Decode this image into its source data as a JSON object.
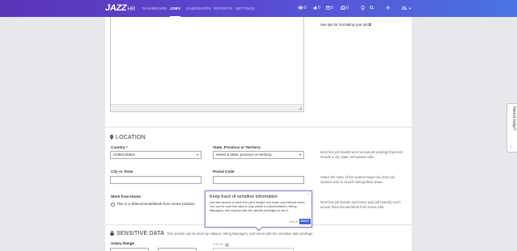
{
  "app": {
    "logo_text": "JAZZ",
    "logo_suffix": "HR",
    "accent_color": "#5a48cf",
    "link_color": "#4a63d8"
  },
  "nav": {
    "items": [
      {
        "label": "DASHBOARD",
        "active": false
      },
      {
        "label": "JOBS",
        "active": true
      },
      {
        "label": "CANDIDATES",
        "active": false
      },
      {
        "label": "REPORTS",
        "active": false
      },
      {
        "label": "SETTINGS",
        "active": false
      }
    ],
    "icons": [
      {
        "name": "eye-icon",
        "count": "0"
      },
      {
        "name": "thumbs-up-icon",
        "count": "0"
      },
      {
        "name": "calendar-icon",
        "count": "0"
      },
      {
        "name": "inbox-icon",
        "count": "0"
      },
      {
        "name": "lightbulb-icon"
      },
      {
        "name": "search-icon"
      },
      {
        "name": "gear-icon"
      }
    ],
    "user_initials": "JG"
  },
  "description": {
    "tips_link": "See tips for formatting your job"
  },
  "location": {
    "title": "LOCATION",
    "country_label": "Country",
    "country_required": "*",
    "country_value": "United States",
    "state_label": "State, Province or Territory",
    "state_placeholder": "Select a state, province or territory...",
    "city_label": "City or Town",
    "city_value": "",
    "postal_label": "Postal Code",
    "postal_value": "",
    "wfh_label": "Work from Home",
    "wfh_option": "This is a Telecommute/Work from Home position.",
    "help_state": "Most free job boards won't accept job postings that don't include a city, state, and postal code.",
    "help_city": "Select the name of the nearest major city since job seekers tend to search metropolitan areas.",
    "help_wfh": "Most free job boards (and some paid job boards) won't accept Telecommute/Work from Home jobs."
  },
  "tour": {
    "title": "Keep track of sensitive information",
    "body": "Use this section to track this job's budget and make any internal notes. You can be sure this data is only visible to Administrators, Hiring Managers, and anyone with the special privileges to see it.",
    "back_label": "BACK",
    "next_label": "NEXT",
    "close_label": "×"
  },
  "sensitive": {
    "title": "SENSITIVE DATA",
    "note": "This section can be seen by Admins, Hiring Managers, and Users with the sensitive data privilege.",
    "salary_label": "Salary Range",
    "job_id_label": "Job ID"
  },
  "feedback": {
    "label": "Need help?"
  }
}
